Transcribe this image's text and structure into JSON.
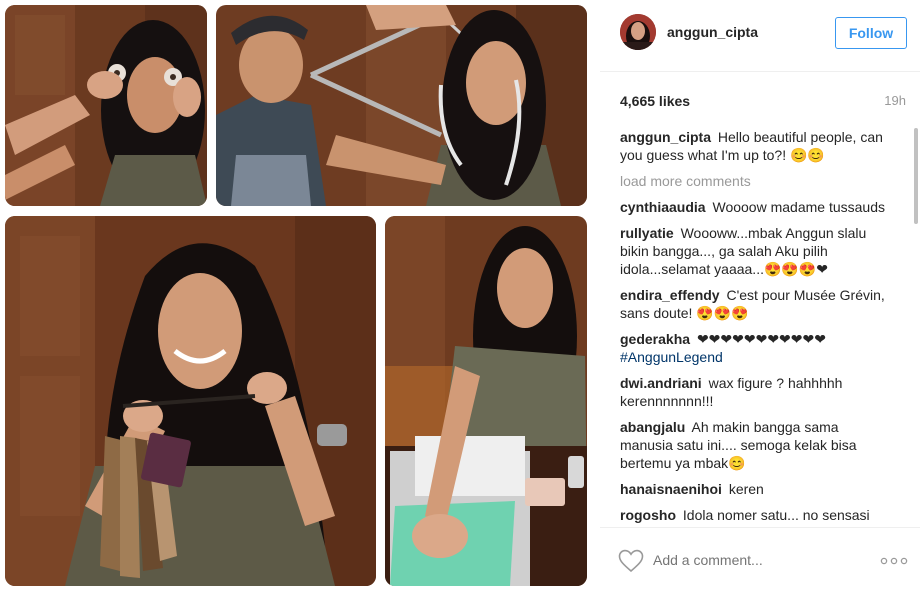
{
  "post": {
    "username": "anggun_cipta",
    "follow_label": "Follow",
    "likes": "4,665 likes",
    "time": "19h",
    "load_more": "load more comments",
    "add_comment_placeholder": "Add a comment..."
  },
  "colors": {
    "accent": "#3897f0",
    "hashtag": "#003569",
    "muted": "#999999"
  },
  "icons": {
    "like": "heart-icon",
    "options": "more-options-icon"
  },
  "caption": {
    "user": "anggun_cipta",
    "text": "Hello beautiful people, can you guess what I'm up to?! 😊😊"
  },
  "comments": [
    {
      "user": "cynthiaaudia",
      "text": "Woooow madame tussauds"
    },
    {
      "user": "rullyatie",
      "text": "Woooww...mbak Anggun slalu bikin bangga..., ga salah Aku pilih idola...selamat yaaaa...😍😍😍❤"
    },
    {
      "user": "endira_effendy",
      "text": "C'est pour Musée Grévin, sans doute! 😍😍😍"
    },
    {
      "user": "gederakha",
      "text": "❤❤❤❤❤❤❤❤❤❤❤",
      "hashtag": "#AnggunLegend"
    },
    {
      "user": "dwi.andriani",
      "text": "wax figure ? hahhhhh kerennnnnnn!!!"
    },
    {
      "user": "abangjalu",
      "text": "Ah makin bangga sama manusia satu ini.... semoga kelak bisa bertemu ya mbak😊"
    },
    {
      "user": "hanaisnaenihoi",
      "text": "keren"
    },
    {
      "user": "rogosho",
      "text": "Idola nomer satu... no sensasi"
    }
  ]
}
